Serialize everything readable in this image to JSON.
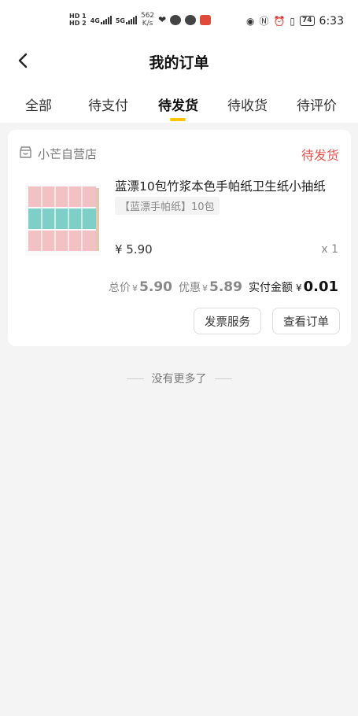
{
  "status_bar": {
    "hd1": "HD 1",
    "hd2": "HD 2",
    "net1": "4G",
    "net2": "5G",
    "speed_value": "562",
    "speed_unit": "K/s",
    "battery": "74",
    "time": "6:33",
    "icons": [
      "heart-rate-icon",
      "wechat-icon",
      "browser-icon",
      "app-icon",
      "eye-icon",
      "nfc-icon",
      "alarm-icon",
      "vibrate-icon"
    ]
  },
  "navbar": {
    "title": "我的订单"
  },
  "tabs": [
    {
      "label": "全部",
      "active": false
    },
    {
      "label": "待支付",
      "active": false
    },
    {
      "label": "待发货",
      "active": true
    },
    {
      "label": "待收货",
      "active": false
    },
    {
      "label": "待评价",
      "active": false
    }
  ],
  "order": {
    "store_name": "小芒自营店",
    "status": "待发货",
    "product_name": "蓝漂10包竹浆本色手帕纸卫生纸小抽纸",
    "spec": "【蓝漂手帕纸】10包",
    "price": "¥ 5.90",
    "quantity": "x 1",
    "total_label": "总价",
    "total_yen": "¥",
    "total_value": "5.90",
    "discount_label": "优惠",
    "discount_yen": "¥",
    "discount_value": "5.89",
    "paid_label": "实付金额",
    "paid_yen": "¥",
    "paid_value": "0.01",
    "buttons": {
      "invoice": "发票服务",
      "view_order": "查看订单"
    }
  },
  "footer": {
    "end_text": "没有更多了"
  },
  "colors": {
    "accent": "#ffc300",
    "status_red": "#e8554e",
    "background": "#f4f4f4"
  }
}
